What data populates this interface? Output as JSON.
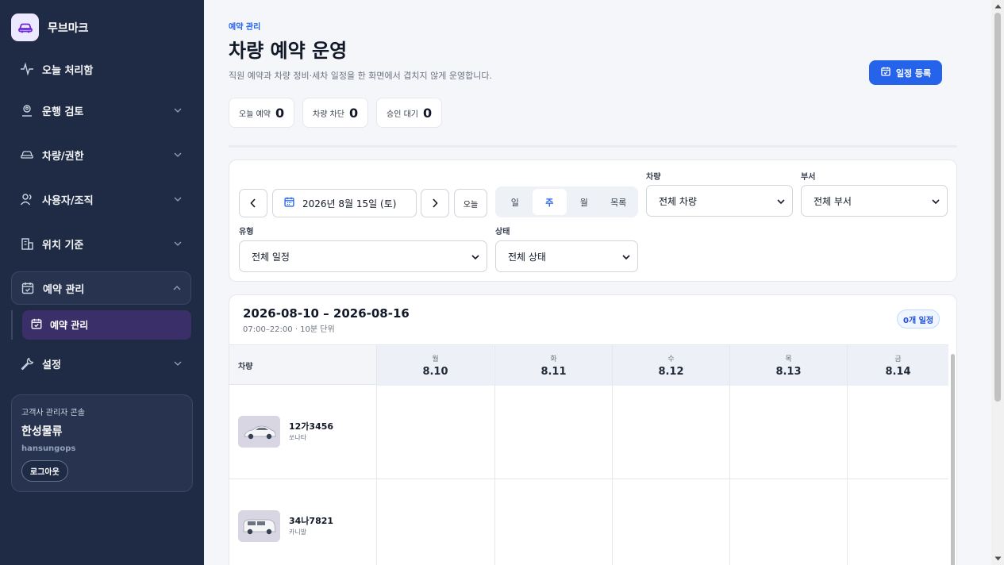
{
  "brand": {
    "name": "무브마크",
    "icon": "car-icon"
  },
  "sidebar": {
    "items": [
      {
        "label": "오늘 처리함",
        "icon": "activity-icon"
      },
      {
        "label": "운행 검토",
        "icon": "map-pin-user-icon"
      },
      {
        "label": "차량/권한",
        "icon": "car-icon"
      },
      {
        "label": "사용자/조직",
        "icon": "users-icon"
      },
      {
        "label": "위치 기준",
        "icon": "building-icon"
      },
      {
        "label": "예약 관리",
        "icon": "calendar-check-icon",
        "expanded": true
      },
      {
        "label": "설정",
        "icon": "wrench-icon"
      }
    ],
    "sub_item": {
      "label": "예약 관리",
      "icon": "calendar-check-icon"
    },
    "account": {
      "role": "고객사 관리자 콘솔",
      "org": "한성물류",
      "user_id": "hansungops",
      "logout_label": "로그아웃"
    }
  },
  "header": {
    "breadcrumb": "예약 관리",
    "title": "차량 예약 운영",
    "description": "직원 예약과 차량 정비·세차 일정을 한 화면에서 겹치지 않게 운영합니다.",
    "primary_button": "일정 등록"
  },
  "stats": [
    {
      "label": "오늘 예약",
      "value": "0"
    },
    {
      "label": "차량 차단",
      "value": "0"
    },
    {
      "label": "승인 대기",
      "value": "0"
    }
  ],
  "filters": {
    "date_label": "2026년 8월 15일 (토)",
    "today_label": "오늘",
    "views": [
      "일",
      "주",
      "월",
      "목록"
    ],
    "active_view": "주",
    "vehicle": {
      "label": "차량",
      "value": "전체 차량"
    },
    "department": {
      "label": "부서",
      "value": "전체 부서"
    },
    "type": {
      "label": "유형",
      "value": "전체 일정"
    },
    "status": {
      "label": "상태",
      "value": "전체 상태"
    }
  },
  "schedule": {
    "range": "2026-08-10 – 2026-08-16",
    "hours": "07:00–22:00 · 10분 단위",
    "count_badge": "0개 일정",
    "vehicle_header": "차량",
    "days": [
      {
        "dow": "월",
        "date": "8.10"
      },
      {
        "dow": "화",
        "date": "8.11"
      },
      {
        "dow": "수",
        "date": "8.12"
      },
      {
        "dow": "목",
        "date": "8.13"
      },
      {
        "dow": "금",
        "date": "8.14"
      }
    ],
    "vehicles": [
      {
        "plate": "12가3456",
        "model": "쏘나타"
      },
      {
        "plate": "34나7821",
        "model": "카니발"
      }
    ]
  },
  "colors": {
    "sidebar_bg": "#1f2a44",
    "accent": "#2563eb",
    "active_sub": "#3b2f6a"
  }
}
